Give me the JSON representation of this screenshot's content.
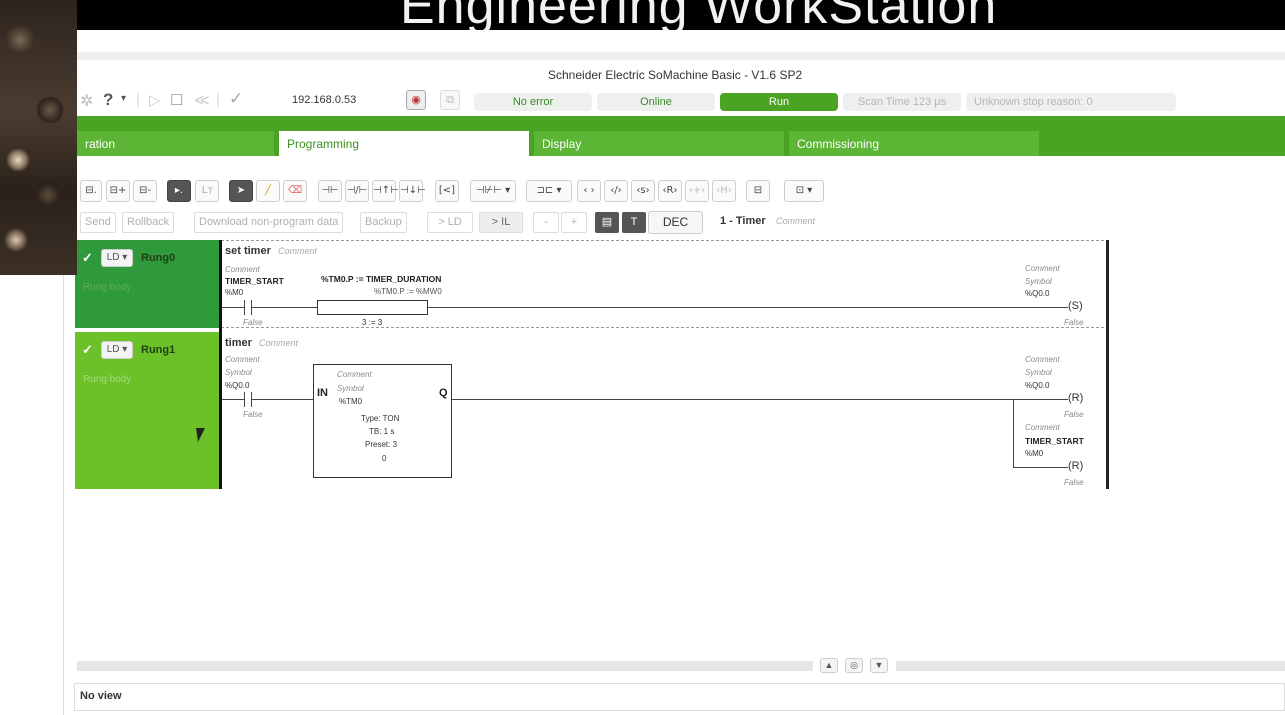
{
  "banner": {
    "text": "Engineering WorkStation"
  },
  "window": {
    "title": "Schneider Electric SoMachine Basic - V1.6 SP2"
  },
  "toolbar": {
    "help_label": "?",
    "ip_address": "192.168.0.53",
    "status": {
      "error": "No error",
      "online": "Online",
      "run": "Run",
      "scan_time": "Scan Time 123 µs",
      "stop_reason": "Unknown stop reason: 0"
    }
  },
  "tabs": [
    {
      "label": "ration"
    },
    {
      "label": "Programming"
    },
    {
      "label": "Display"
    },
    {
      "label": "Commissioning"
    }
  ],
  "ladder_tools": {
    "dec_label": "DEC",
    "program_name": "1 - Timer",
    "program_comment": "Comment"
  },
  "row3_buttons": {
    "send": "Send",
    "rollback": "Rollback",
    "download": "Download non-program data",
    "backup": "Backup",
    "to_ld": "> LD",
    "to_il": "> IL",
    "minus": "-",
    "plus": "+"
  },
  "rungs": [
    {
      "check": "✓",
      "mode": "LD ▾",
      "name": "Rung0",
      "body_label": "Rung body",
      "title": "set timer",
      "title_comment": "Comment",
      "contact": {
        "comment": "Comment",
        "symbol": "TIMER_START",
        "address": "%M0",
        "state": "False"
      },
      "operation": {
        "line1": "%TM0.P := TIMER_DURATION",
        "line2": "%TM0.P := %MW0",
        "value": "3 := 3"
      },
      "coil": {
        "comment": "Comment",
        "symbol": "Symbol",
        "address": "%Q0.0",
        "state": "False",
        "type": "S"
      }
    },
    {
      "check": "✓",
      "mode": "LD ▾",
      "name": "Rung1",
      "body_label": "Rung body",
      "title": "timer",
      "title_comment": "Comment",
      "contact": {
        "comment": "Comment",
        "symbol": "Symbol",
        "address": "%Q0.0",
        "state": "False"
      },
      "timer": {
        "comment": "Comment",
        "symbol": "Symbol",
        "address": "%TM0",
        "in": "IN",
        "q": "Q",
        "type": "Type: TON",
        "tb": "TB: 1 s",
        "preset": "Preset: 3",
        "value": "0"
      },
      "coil1": {
        "comment": "Comment",
        "symbol": "Symbol",
        "address": "%Q0.0",
        "state": "False",
        "type": "R"
      },
      "coil2": {
        "comment": "Comment",
        "symbol": "TIMER_START",
        "address": "%M0",
        "state": "False",
        "type": "R"
      }
    }
  ],
  "bottom": {
    "no_view": "No view"
  }
}
